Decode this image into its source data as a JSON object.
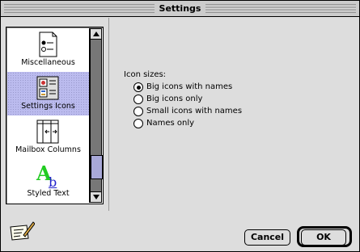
{
  "window": {
    "title": "Settings"
  },
  "icon_list": {
    "items": [
      {
        "label": "Miscellaneous",
        "icon": "miscellaneous-icon"
      },
      {
        "label": "Settings Icons",
        "icon": "settings-icons-icon",
        "selected": true
      },
      {
        "label": "Mailbox Columns",
        "icon": "mailbox-columns-icon"
      },
      {
        "label": "Styled Text",
        "icon": "styled-text-icon"
      }
    ]
  },
  "icon_sizes": {
    "label": "Icon sizes:",
    "options": [
      {
        "label": "Big icons with names",
        "checked": true
      },
      {
        "label": "Big icons only",
        "checked": false
      },
      {
        "label": "Small icons with names",
        "checked": false
      },
      {
        "label": "Names only",
        "checked": false
      }
    ]
  },
  "buttons": {
    "cancel": "Cancel",
    "ok": "OK"
  },
  "colors": {
    "selection": "#bbbbee",
    "scroll_thumb": "#a8a8d8",
    "window_bg": "#dddddd"
  }
}
